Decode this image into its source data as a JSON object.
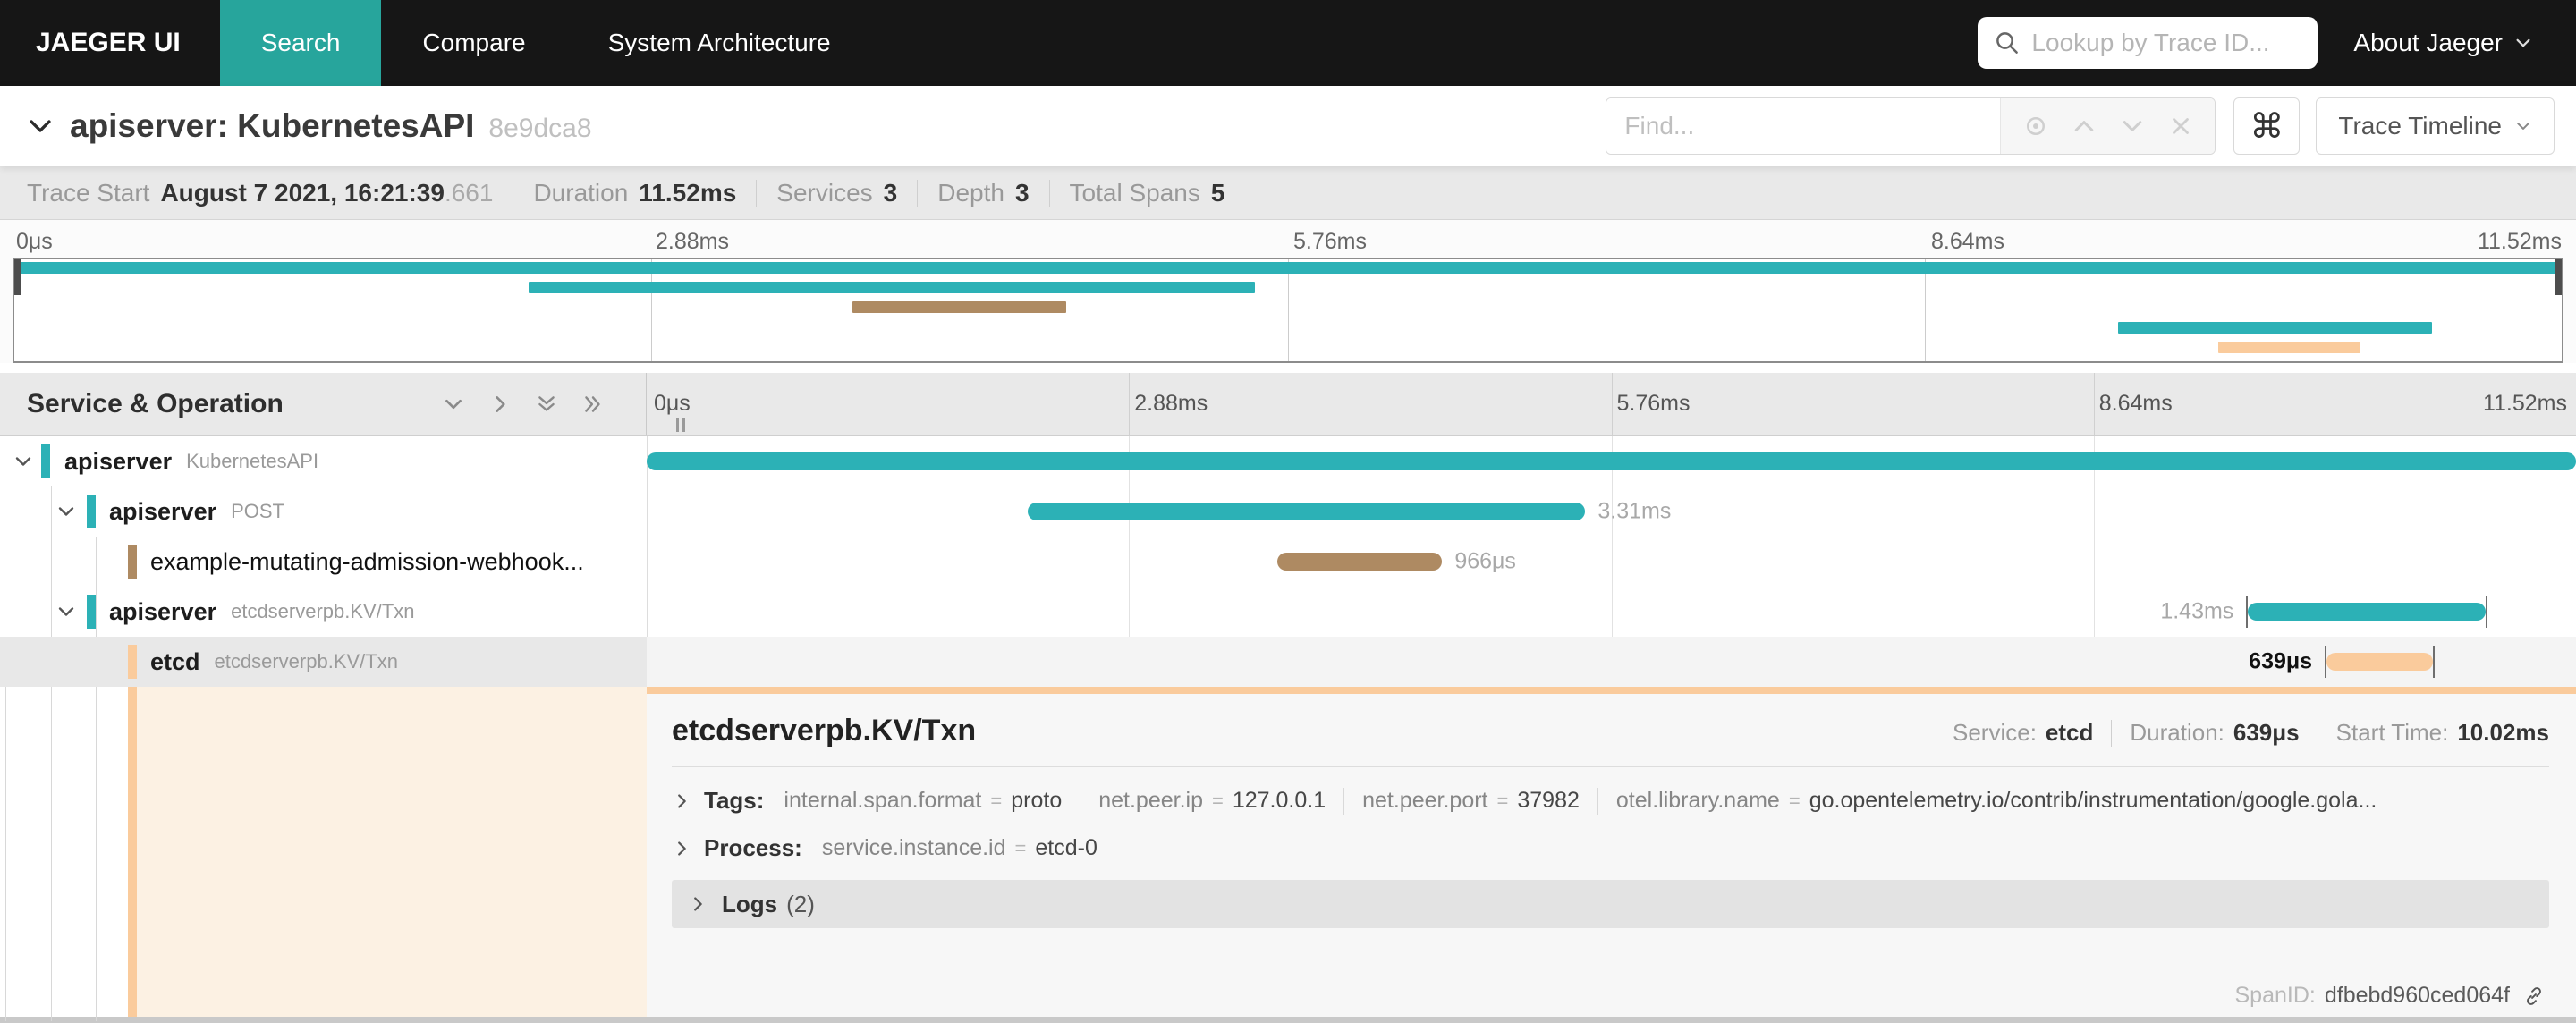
{
  "nav": {
    "brand": "JAEGER UI",
    "items": [
      "Search",
      "Compare",
      "System Architecture"
    ],
    "lookup_placeholder": "Lookup by Trace ID...",
    "about_label": "About Jaeger"
  },
  "trace_header": {
    "title": "apiserver: KubernetesAPI",
    "trace_id": "8e9dca8",
    "find_placeholder": "Find...",
    "command_symbol": "⌘",
    "view_label": "Trace Timeline"
  },
  "summary": {
    "trace_start_label": "Trace Start",
    "trace_start_value": "August 7 2021, 16:21:39",
    "trace_start_fraction": ".661",
    "duration_label": "Duration",
    "duration_value": "11.52ms",
    "services_label": "Services",
    "services_value": "3",
    "depth_label": "Depth",
    "depth_value": "3",
    "total_spans_label": "Total Spans",
    "total_spans_value": "5"
  },
  "minimap": {
    "ticks": [
      "0μs",
      "2.88ms",
      "5.76ms",
      "8.64ms",
      "11.52ms"
    ],
    "bars": [
      {
        "left": "0%",
        "width": "100%",
        "color": "#2CB1B6"
      },
      {
        "left": "20.2%",
        "width": "28.5%",
        "color": "#2CB1B6"
      },
      {
        "left": "32.9%",
        "width": "8.4%",
        "color": "#AE8A62"
      },
      {
        "left": "82.6%",
        "width": "12.3%",
        "color": "#2CB1B6"
      },
      {
        "left": "86.5%",
        "width": "5.6%",
        "color": "#FACB9C"
      }
    ]
  },
  "timeline": {
    "header": "Service & Operation",
    "ticks": [
      "0μs",
      "2.88ms",
      "5.76ms",
      "8.64ms",
      "11.52ms"
    ],
    "spans": [
      {
        "service": "apiserver",
        "operation": "KubernetesAPI",
        "bar": {
          "left": "0%",
          "width": "100%",
          "color": "#2CB1B6"
        },
        "label": ""
      },
      {
        "service": "apiserver",
        "operation": "POST",
        "bar": {
          "left": "19.75%",
          "width": "28.9%",
          "color": "#2CB1B6"
        },
        "label": "3.31ms"
      },
      {
        "service": "example-mutating-admission-webhook...",
        "operation": "",
        "bar": {
          "left": "32.7%",
          "width": "8.53%",
          "color": "#AE8A62"
        },
        "label": "966μs"
      },
      {
        "service": "apiserver",
        "operation": "etcdserverpb.KV/Txn",
        "bar": {
          "left": "83.0%",
          "width": "12.33%",
          "color": "#2CB1B6"
        },
        "label": "1.43ms"
      },
      {
        "service": "etcd",
        "operation": "etcdserverpb.KV/Txn",
        "bar": {
          "left": "87.07%",
          "width": "5.52%",
          "color": "#FACB9C"
        },
        "label": "639μs"
      }
    ]
  },
  "detail": {
    "title": "etcdserverpb.KV/Txn",
    "service_label": "Service:",
    "service_value": "etcd",
    "duration_label": "Duration:",
    "duration_value": "639μs",
    "start_label": "Start Time:",
    "start_value": "10.02ms",
    "eq": "=",
    "tags_label": "Tags:",
    "tags": [
      {
        "key": "internal.span.format",
        "value": "proto"
      },
      {
        "key": "net.peer.ip",
        "value": "127.0.0.1"
      },
      {
        "key": "net.peer.port",
        "value": "37982"
      },
      {
        "key": "otel.library.name",
        "value": "go.opentelemetry.io/contrib/instrumentation/google.gola..."
      }
    ],
    "process_label": "Process:",
    "process_key": "service.instance.id",
    "process_value": "etcd-0",
    "logs_label": "Logs",
    "logs_count": "(2)",
    "spanid_label": "SpanID:",
    "spanid_value": "dfbebd960ced064f"
  }
}
